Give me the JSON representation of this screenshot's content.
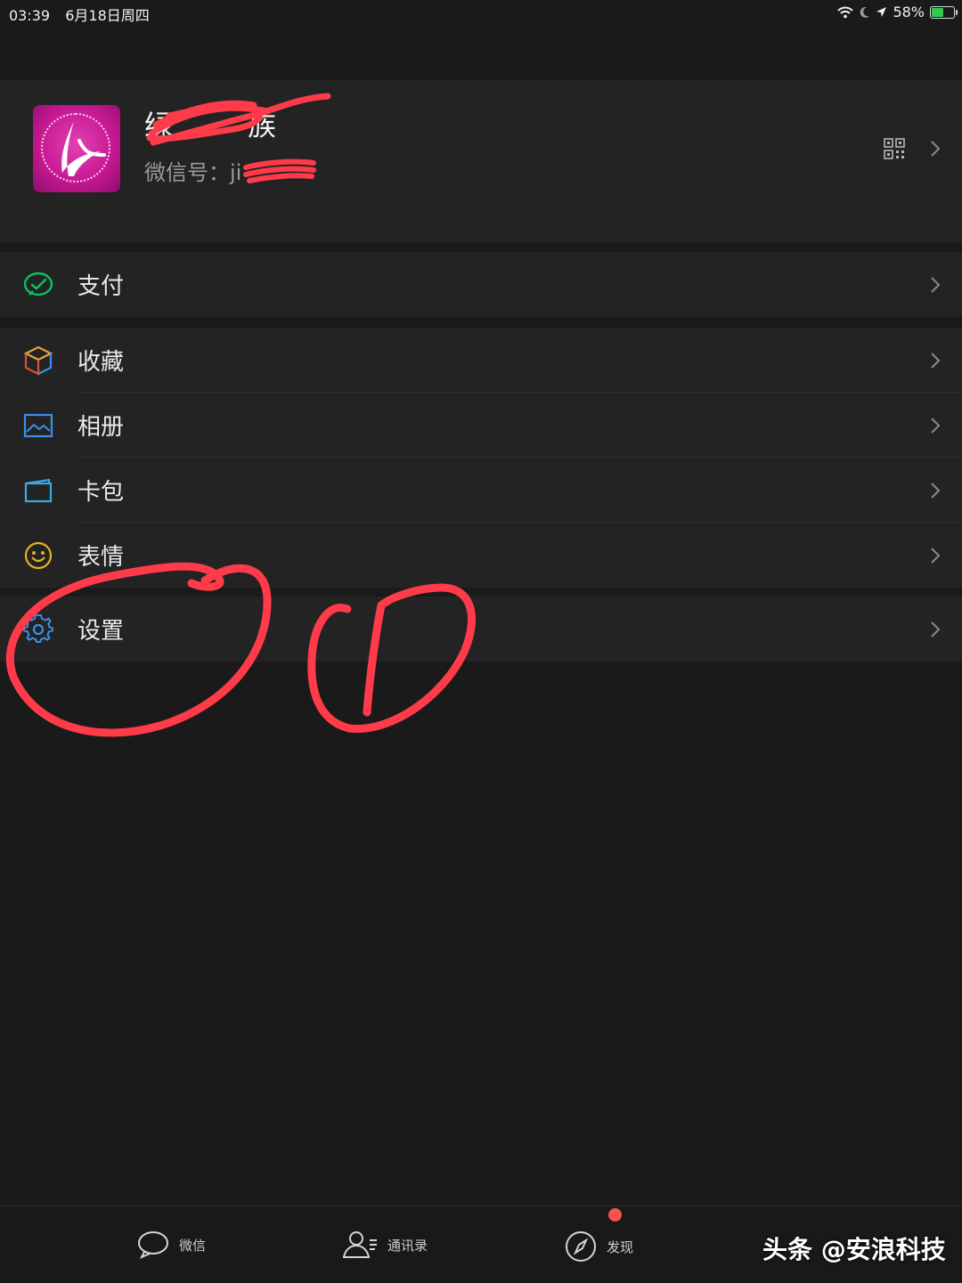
{
  "status_bar": {
    "time": "03:39",
    "date": "6月18日周四",
    "battery": "58%",
    "battery_level": 0.58
  },
  "profile": {
    "nickname": "绿",
    "nickname_end": "族",
    "wechat_id_label": "微信号：",
    "wechat_id_prefix": "ji"
  },
  "menu_groups": [
    [
      {
        "label": "支付",
        "icon": "wechat-pay-icon"
      }
    ],
    [
      {
        "label": "收藏",
        "icon": "favorites-cube-icon"
      },
      {
        "label": "相册",
        "icon": "album-icon"
      },
      {
        "label": "卡包",
        "icon": "card-wallet-icon"
      },
      {
        "label": "表情",
        "icon": "smiley-icon"
      }
    ],
    [
      {
        "label": "设置",
        "icon": "gear-icon"
      }
    ]
  ],
  "tabbar": [
    {
      "label": "微信",
      "icon": "chat-bubble-icon"
    },
    {
      "label": "通讯录",
      "icon": "contacts-icon"
    },
    {
      "label": "发现",
      "icon": "compass-icon"
    }
  ],
  "watermark": "头条 @安浪科技",
  "colors": {
    "background": "#1a1a1a",
    "cell": "#232323",
    "pay_green": "#07c160",
    "blue": "#3d8fe6",
    "badge": "#fa5151",
    "annotation": "#ff3b4a"
  }
}
